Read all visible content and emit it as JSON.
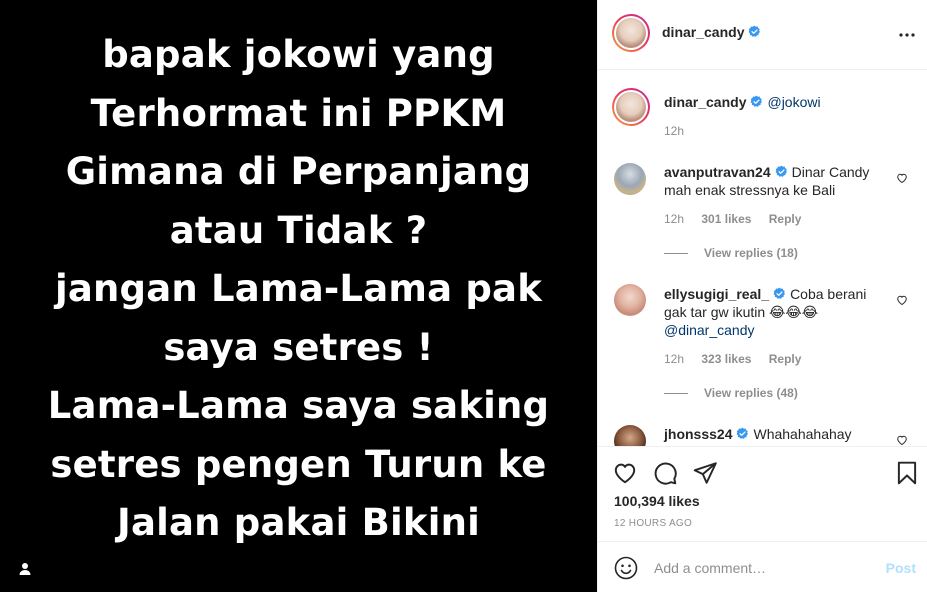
{
  "media": {
    "lines": [
      "bapak jokowi yang",
      "Terhormat ini PPKM",
      "Gimana di Perpanjang",
      "atau Tidak ?",
      "jangan Lama-Lama pak",
      "saya setres !",
      "Lama-Lama saya saking",
      "setres pengen Turun ke",
      "Jalan pakai Bikini"
    ],
    "tag_icon": "person-tag-icon"
  },
  "header": {
    "username": "dinar_candy",
    "verified_icon": "verified-badge-icon",
    "more_icon": "more-options-icon"
  },
  "caption": {
    "username": "dinar_candy",
    "text": "@jokowi",
    "time": "12h"
  },
  "comments": [
    {
      "username": "avanputravan24",
      "text": "Dinar Candy mah enak stressnya ke Bali",
      "time": "12h",
      "likes": "301 likes",
      "reply": "Reply",
      "view_replies": "View replies (18)"
    },
    {
      "username": "ellysugigi_real_",
      "text": "Coba berani gak tar gw ikutin 😂😂😂",
      "mention": "@dinar_candy",
      "time": "12h",
      "likes": "323 likes",
      "reply": "Reply",
      "view_replies": "View replies (48)"
    },
    {
      "username": "jhonsss24",
      "text": "Whahahahahay"
    }
  ],
  "actions": {
    "like_icon": "heart-icon",
    "comment_icon": "comment-icon",
    "share_icon": "share-icon",
    "save_icon": "bookmark-icon",
    "likes": "100,394 likes",
    "time_ago": "12 HOURS AGO"
  },
  "add_comment": {
    "placeholder": "Add a comment…",
    "post_label": "Post",
    "emoji_icon": "emoji-icon"
  },
  "colors": {
    "verified": "#3897f0",
    "mention": "#00376b",
    "post_disabled": "#b2dffc"
  }
}
